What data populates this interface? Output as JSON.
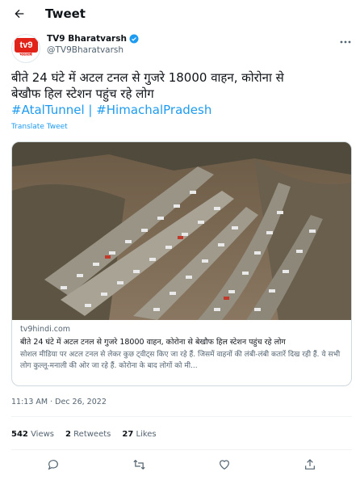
{
  "header": {
    "title": "Tweet"
  },
  "author": {
    "name": "TV9 Bharatvarsh",
    "handle": "@TV9Bharatvarsh",
    "avatar_text": "tv9",
    "avatar_subtext": "भारतवर्ष"
  },
  "tweet": {
    "text_line1": "बीते 24 घंटे में अटल टनल से गुजरे 18000 वाहन, कोरोना से",
    "text_line2": "बेखौफ हिल स्टेशन पहुंच रहे लोग",
    "hashtag1": "#AtalTunnel",
    "separator": " | ",
    "hashtag2": "#HimachalPradesh",
    "translate_label": "Translate Tweet"
  },
  "card": {
    "domain": "tv9hindi.com",
    "title": "बीते 24 घंटे में अटल टनल से गुजरे 18000 वाहन, कोरोना से बेखौफ हिल स्टेशन पहुंच रहे लोग",
    "description": "सोशल मीडिया पर अटल टनल से लेकर कुछ ट्वीट्स किए जा रहे हैं. जिसमें वाहनों की लंबी-लंबी कतारें दिख रही हैं. ये सभी लोग कुल्लू-मनाली की ओर जा रहे हैं. कोरोना के बाद लोगों को मी..."
  },
  "meta": {
    "time": "11:13 AM",
    "dot": " · ",
    "date": "Dec 26, 2022"
  },
  "stats": {
    "views_count": "542",
    "views_label": "Views",
    "retweets_count": "2",
    "retweets_label": "Retweets",
    "likes_count": "27",
    "likes_label": "Likes"
  },
  "colors": {
    "accent": "#1d9bf0",
    "text": "#0f1419",
    "secondary": "#536471",
    "border": "#cfd9de"
  },
  "icons": [
    "back-arrow-icon",
    "verified-badge-icon",
    "more-icon",
    "reply-icon",
    "retweet-icon",
    "like-icon",
    "share-icon"
  ]
}
